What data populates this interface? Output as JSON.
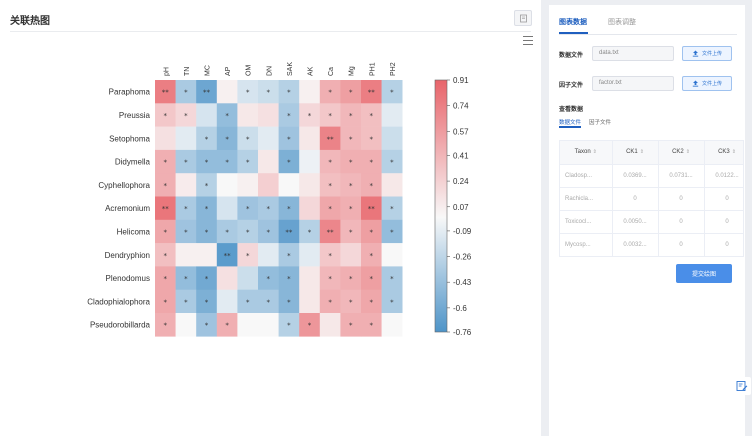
{
  "left_panel": {
    "title": "关联热图"
  },
  "right_panel": {
    "tabs": [
      {
        "label": "图表数据",
        "active": true
      },
      {
        "label": "图表调整",
        "active": false
      }
    ],
    "data_file": {
      "label": "数据文件",
      "value": "data.txt",
      "button_label": "文件上传"
    },
    "factor_file": {
      "label": "因子文件",
      "value": "factor.txt",
      "button_label": "文件上传"
    },
    "view_data": {
      "title": "查看数据",
      "subtabs": [
        {
          "label": "数据文件",
          "active": true
        },
        {
          "label": "因子文件",
          "active": false
        }
      ]
    },
    "table": {
      "columns": [
        "Taxon",
        "CK1",
        "CK2",
        "CK3"
      ],
      "rows": [
        [
          "Cladosp...",
          "0.0369...",
          "0.0731...",
          "0.0122..."
        ],
        [
          "Rachicla...",
          "0",
          "0",
          "0"
        ],
        [
          "Toxicocl...",
          "0.0050...",
          "0",
          "0"
        ],
        [
          "Mycosp...",
          "0.0032...",
          "0",
          "0"
        ]
      ]
    },
    "submit_label": "提交绘图"
  },
  "colors": {
    "accent": "#1f5fbf",
    "positive": "#e8646a",
    "negative": "#4a90c8"
  },
  "chart_data": {
    "type": "heatmap",
    "columns": [
      "pH",
      "TN",
      "MC",
      "AP",
      "OM",
      "DN",
      "SAK",
      "AK",
      "Ca",
      "Mg",
      "PH1",
      "PH2"
    ],
    "rows": [
      "Paraphoma",
      "Preussia",
      "Setophoma",
      "Didymella",
      "Cyphellophora",
      "Acremonium",
      "Helicoma",
      "Dendryphion",
      "Plenodomus",
      "Cladophialophora",
      "Pseudorobillarda"
    ],
    "values": [
      [
        0.75,
        -0.35,
        -0.62,
        0.05,
        -0.15,
        -0.2,
        -0.3,
        0.05,
        0.45,
        0.55,
        0.75,
        -0.3
      ],
      [
        0.3,
        0.2,
        -0.15,
        -0.45,
        0.1,
        0.15,
        -0.35,
        0.2,
        0.3,
        0.4,
        0.35,
        -0.1
      ],
      [
        0.15,
        -0.1,
        -0.3,
        -0.5,
        -0.2,
        -0.1,
        -0.4,
        0.1,
        0.72,
        0.4,
        0.35,
        -0.2
      ],
      [
        0.45,
        -0.35,
        -0.45,
        -0.45,
        -0.3,
        0.1,
        -0.55,
        -0.05,
        0.4,
        0.45,
        0.45,
        -0.3
      ],
      [
        0.45,
        0.08,
        -0.3,
        0,
        0.05,
        0.25,
        0,
        0.1,
        0.35,
        0.4,
        0.45,
        0.1
      ],
      [
        0.8,
        -0.35,
        -0.5,
        -0.15,
        -0.4,
        -0.35,
        -0.5,
        0.2,
        0.5,
        0.45,
        0.8,
        -0.3
      ],
      [
        0.5,
        -0.4,
        -0.5,
        -0.35,
        -0.3,
        -0.4,
        -0.65,
        -0.3,
        0.7,
        0.4,
        0.55,
        -0.45
      ],
      [
        0.35,
        0.05,
        0.05,
        -0.7,
        0.2,
        -0.1,
        -0.35,
        -0.1,
        0.3,
        0.2,
        0.45,
        0
      ],
      [
        0.5,
        -0.45,
        -0.6,
        0.15,
        -0.2,
        -0.45,
        -0.5,
        0.1,
        0.4,
        0.45,
        0.55,
        -0.35
      ],
      [
        0.5,
        -0.35,
        -0.55,
        -0.1,
        -0.35,
        -0.35,
        -0.5,
        0.1,
        0.45,
        0.4,
        0.5,
        -0.35
      ],
      [
        0.45,
        0,
        -0.4,
        0.45,
        0,
        0,
        -0.3,
        0.6,
        0.1,
        0.45,
        0.45,
        0
      ]
    ],
    "significance": [
      [
        "**",
        "*",
        "**",
        "",
        "*",
        "*",
        "*",
        "",
        "*",
        "*",
        "**",
        "*"
      ],
      [
        "*",
        "*",
        "",
        "*",
        "",
        "",
        "*",
        "*",
        "*",
        "*",
        "*",
        ""
      ],
      [
        "",
        "",
        "*",
        "*",
        "*",
        "",
        "*",
        "",
        "**",
        "*",
        "*",
        ""
      ],
      [
        "*",
        "*",
        "*",
        "*",
        "*",
        "",
        "*",
        "",
        "*",
        "*",
        "*",
        "*"
      ],
      [
        "*",
        "",
        "*",
        "",
        "",
        "",
        "",
        "",
        "*",
        "*",
        "*",
        ""
      ],
      [
        "**",
        "*",
        "*",
        "",
        "*",
        "*",
        "*",
        "",
        "*",
        "*",
        "**",
        "*"
      ],
      [
        "*",
        "*",
        "*",
        "*",
        "*",
        "*",
        "**",
        "*",
        "**",
        "*",
        "*",
        "*"
      ],
      [
        "*",
        "",
        "",
        "**",
        "*",
        "",
        "*",
        "",
        "*",
        "",
        "*",
        ""
      ],
      [
        "*",
        "*",
        "*",
        "",
        "",
        "*",
        "*",
        "",
        "*",
        "*",
        "*",
        "*"
      ],
      [
        "*",
        "*",
        "*",
        "",
        "*",
        "*",
        "*",
        "",
        "*",
        "*",
        "*",
        "*"
      ],
      [
        "*",
        "",
        "*",
        "*",
        "",
        "",
        "*",
        "*",
        "",
        "*",
        "*",
        ""
      ]
    ],
    "colorbar": {
      "range": [
        -0.76,
        0.91
      ],
      "ticks": [
        0.91,
        0.74,
        0.57,
        0.41,
        0.24,
        0.07,
        -0.09,
        -0.26,
        -0.43,
        -0.6,
        -0.76
      ],
      "tick_labels": [
        "0.91",
        "0.74",
        "0.57",
        "0.41",
        "0.24",
        "0.07",
        "-0.09",
        "-0.26",
        "-0.43",
        "-0.6",
        "-0.76"
      ],
      "placement": "right"
    }
  }
}
